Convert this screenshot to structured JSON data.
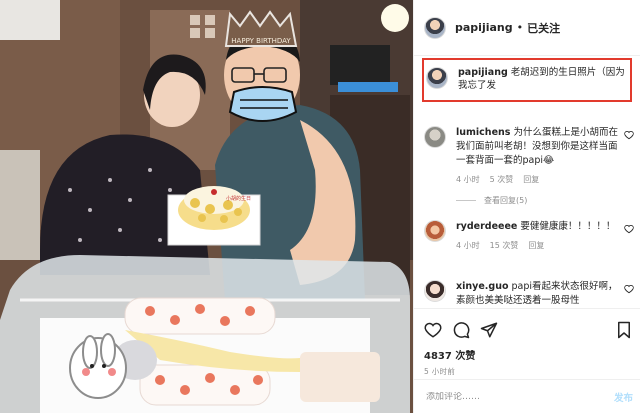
{
  "photo": {
    "crown_text": "HAPPY BIRTHDAY",
    "cake_text": "小胡的生日"
  },
  "header": {
    "username": "papijiang",
    "separator": "•",
    "follow_status": "已关注"
  },
  "caption": {
    "username": "papijiang",
    "text": "老胡迟到的生日照片（因为我忘了发"
  },
  "comments": [
    {
      "username": "lumichens",
      "text": "为什么蛋糕上是小胡而在我们面前叫老胡！没想到你是这样当面一套背面一套的papi😂",
      "time": "4 小时",
      "likes": "5 次赞",
      "reply": "回复"
    },
    {
      "username": "ryderdeeee",
      "text": "要健健康康！！！！！",
      "time": "4 小时",
      "likes": "15 次赞",
      "reply": "回复"
    },
    {
      "username": "xinye.guo",
      "text": "papi看起来状态很好啊，素颜也美美哒还透着一股母性",
      "time": "",
      "likes": "",
      "reply": ""
    }
  ],
  "view_replies": "查看回复(5)",
  "actions": {
    "likes": "4837 次赞",
    "time": "5 小时前"
  },
  "add_comment": {
    "placeholder": "添加评论……",
    "post_label": "发布"
  },
  "colors": {
    "highlight_border": "#e23a2d",
    "post_disabled": "#b2dffc",
    "meta_gray": "#8e8e8e"
  }
}
